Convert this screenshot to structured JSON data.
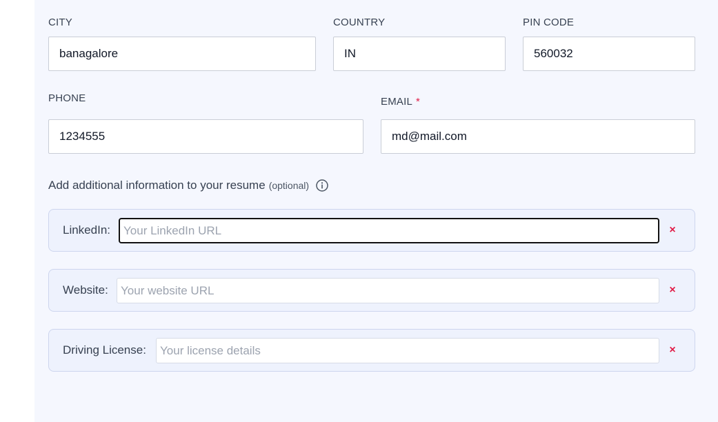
{
  "address": {
    "city": {
      "label": "CITY",
      "value": "banagalore"
    },
    "country": {
      "label": "COUNTRY",
      "value": "IN"
    },
    "pin_code": {
      "label": "PIN CODE",
      "value": "560032"
    }
  },
  "contact": {
    "phone": {
      "label": "PHONE",
      "value": "1234555"
    },
    "email": {
      "label": "EMAIL",
      "required_mark": "*",
      "value": "md@mail.com"
    }
  },
  "additional": {
    "heading": "Add additional information to your resume",
    "optional_text": "(optional)",
    "info_icon": "info-circle-icon",
    "fields": [
      {
        "label": "LinkedIn:",
        "placeholder": "Your LinkedIn URL",
        "value": "",
        "remove_glyph": "×"
      },
      {
        "label": "Website:",
        "placeholder": "Your website URL",
        "value": "",
        "remove_glyph": "×"
      },
      {
        "label": "Driving License:",
        "placeholder": "Your license details",
        "value": "",
        "remove_glyph": "×"
      }
    ]
  },
  "colors": {
    "panel_bg": "#f5f7fe",
    "extra_box_bg": "#eef2fd",
    "required_red": "#e11d48",
    "remove_red": "#e11d48"
  }
}
